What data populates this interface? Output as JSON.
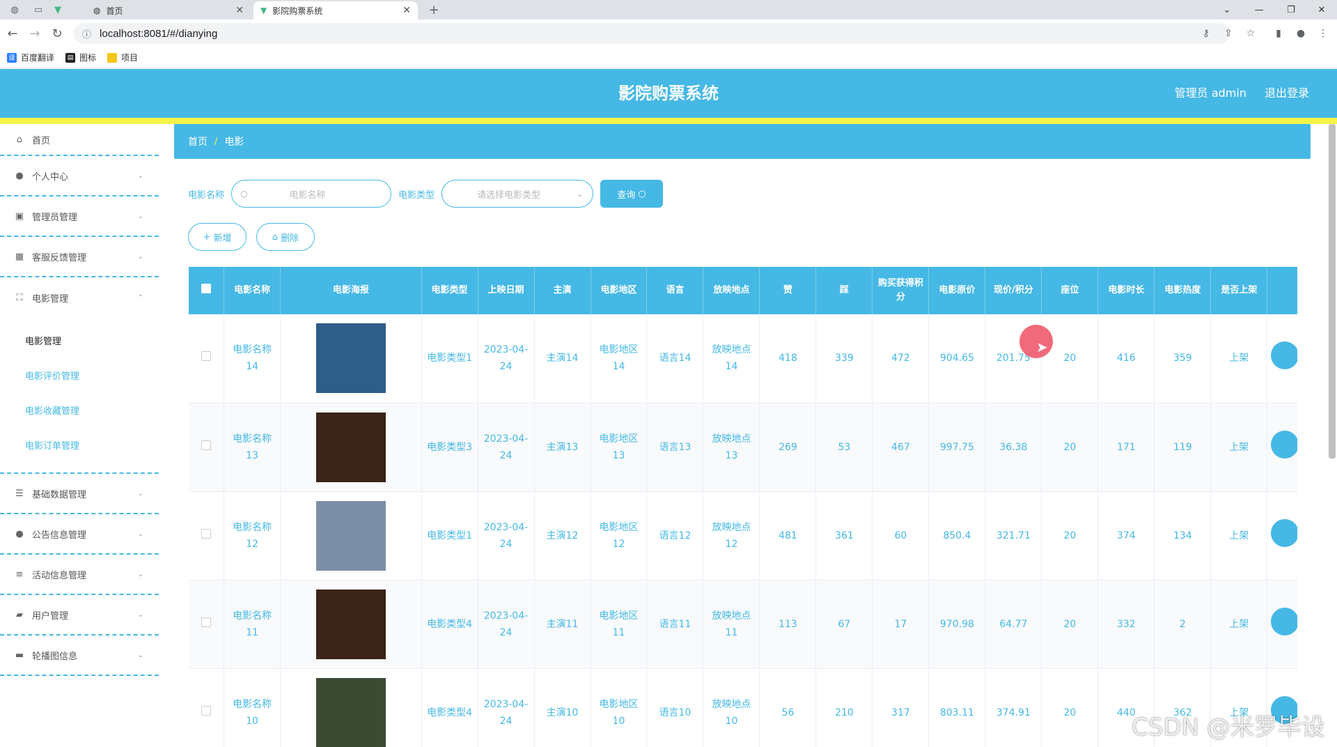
{
  "browser": {
    "tabs": [
      {
        "title": "首页"
      },
      {
        "title": "影院购票系统"
      }
    ],
    "new_tab": "+",
    "url": "localhost:8081/#/dianying",
    "bookmarks": [
      {
        "label": "百度翻译",
        "color": "#2d7ff9"
      },
      {
        "label": "图标",
        "color": "#222222"
      },
      {
        "label": "项目",
        "color": "#f5c518"
      }
    ]
  },
  "header": {
    "title": "影院购票系统",
    "user": "管理员 admin",
    "logout": "退出登录"
  },
  "sidebar": {
    "items": [
      {
        "label": "首页",
        "icon": "home-icon"
      },
      {
        "label": "个人中心",
        "icon": "user-icon"
      },
      {
        "label": "管理员管理",
        "icon": "admin-icon"
      },
      {
        "label": "客服反馈管理",
        "icon": "grid-icon"
      },
      {
        "label": "电影管理",
        "icon": "film-icon"
      },
      {
        "label": "基础数据管理",
        "icon": "sliders-icon"
      },
      {
        "label": "公告信息管理",
        "icon": "user-icon"
      },
      {
        "label": "活动信息管理",
        "icon": "list-icon"
      },
      {
        "label": "用户管理",
        "icon": "user-group-icon"
      },
      {
        "label": "轮播图信息",
        "icon": "image-icon"
      }
    ],
    "submenu": [
      "电影管理",
      "电影评价管理",
      "电影收藏管理",
      "电影订单管理"
    ]
  },
  "breadcrumb": {
    "home": "首页",
    "current": "电影"
  },
  "search": {
    "name_label": "电影名称",
    "name_placeholder": "电影名称",
    "type_label": "电影类型",
    "type_placeholder": "请选择电影类型",
    "query_button": "查询"
  },
  "actions": {
    "add": "新增",
    "delete": "删除"
  },
  "table": {
    "headers": [
      "电影名称",
      "电影海报",
      "电影类型",
      "上映日期",
      "主演",
      "电影地区",
      "语言",
      "放映地点",
      "赞",
      "踩",
      "购买获得积分",
      "电影原价",
      "现价/积分",
      "座位",
      "电影时长",
      "电影热度",
      "是否上架"
    ],
    "rows": [
      {
        "name": "电影名称14",
        "type": "电影类型1",
        "date": "2023-04-24",
        "actor": "主演14",
        "region": "电影地区14",
        "lang": "语言14",
        "place": "放映地点14",
        "up": "418",
        "down": "339",
        "points": "472",
        "orig": "904.65",
        "now": "201.75",
        "seat": "20",
        "duration": "416",
        "heat": "359",
        "onsale": "上架",
        "poster": "#2f5d8a"
      },
      {
        "name": "电影名称13",
        "type": "电影类型3",
        "date": "2023-04-24",
        "actor": "主演13",
        "region": "电影地区13",
        "lang": "语言13",
        "place": "放映地点13",
        "up": "269",
        "down": "53",
        "points": "467",
        "orig": "997.75",
        "now": "36.38",
        "seat": "20",
        "duration": "171",
        "heat": "119",
        "onsale": "上架",
        "poster": "#3a2418"
      },
      {
        "name": "电影名称12",
        "type": "电影类型1",
        "date": "2023-04-24",
        "actor": "主演12",
        "region": "电影地区12",
        "lang": "语言12",
        "place": "放映地点12",
        "up": "481",
        "down": "361",
        "points": "60",
        "orig": "850.4",
        "now": "321.71",
        "seat": "20",
        "duration": "374",
        "heat": "134",
        "onsale": "上架",
        "poster": "#7d8fa8"
      },
      {
        "name": "电影名称11",
        "type": "电影类型4",
        "date": "2023-04-24",
        "actor": "主演11",
        "region": "电影地区11",
        "lang": "语言11",
        "place": "放映地点11",
        "up": "113",
        "down": "67",
        "points": "17",
        "orig": "970.98",
        "now": "64.77",
        "seat": "20",
        "duration": "332",
        "heat": "2",
        "onsale": "上架",
        "poster": "#3a2418"
      },
      {
        "name": "电影名称10",
        "type": "电影类型4",
        "date": "2023-04-24",
        "actor": "主演10",
        "region": "电影地区10",
        "lang": "语言10",
        "place": "放映地点10",
        "up": "56",
        "down": "210",
        "points": "317",
        "orig": "803.11",
        "now": "374.91",
        "seat": "20",
        "duration": "440",
        "heat": "362",
        "onsale": "上架",
        "poster": "#3d4a33"
      }
    ]
  },
  "watermark": "CSDN @米罗毕设",
  "colors": {
    "accent": "#45b8e5",
    "strip": "#f4f449"
  }
}
